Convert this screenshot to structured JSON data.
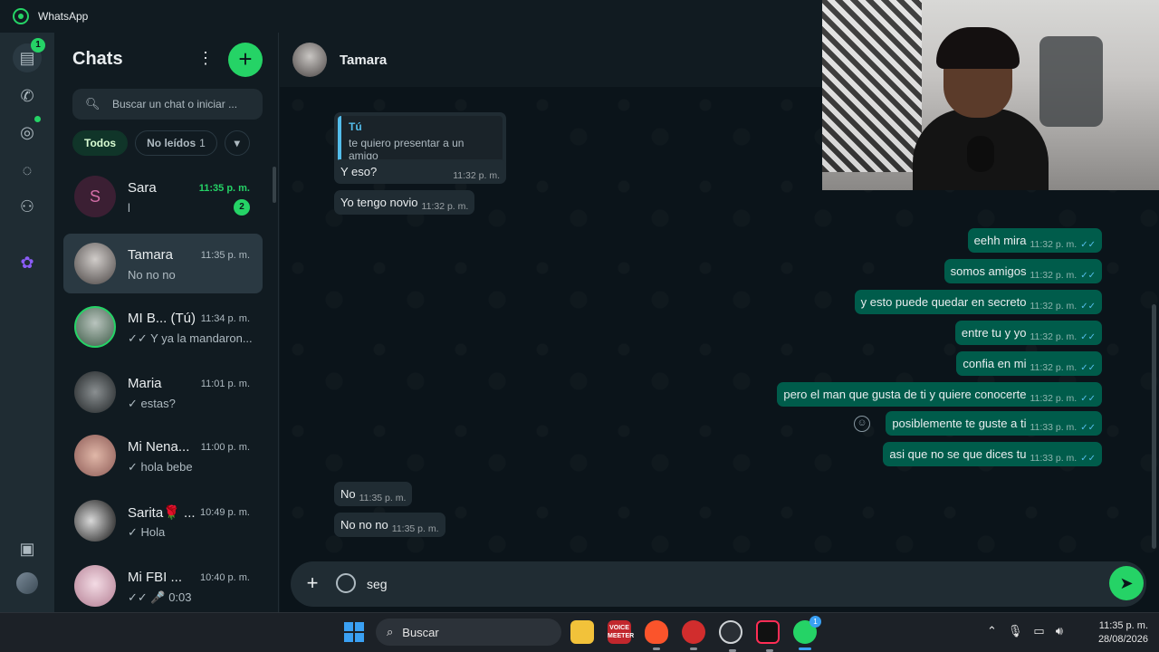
{
  "window": {
    "title": "WhatsApp"
  },
  "rail": {
    "chats_badge": "1"
  },
  "chat_list": {
    "title": "Chats",
    "search_placeholder": "Buscar un chat o iniciar ...",
    "filters": {
      "all": "Todos",
      "unread": "No leídos",
      "unread_count": "1"
    },
    "items": [
      {
        "name": "Sara",
        "time": "11:35 p. m.",
        "preview": "l",
        "unread": "2",
        "avatar_letter": "S",
        "avatar_color": "#3b1f33"
      },
      {
        "name": "Tamara",
        "time": "11:35 p. m.",
        "preview": "No no no",
        "avatar_color": "#8f8a86"
      },
      {
        "name": "MI B... (Tú)",
        "time": "11:34 p. m.",
        "preview": "✓✓ Y ya la mandaron...",
        "avatar_color": "#5a7a62"
      },
      {
        "name": "Maria",
        "time": "11:01 p. m.",
        "preview": "✓ estas?",
        "avatar_color": "#3e4447"
      },
      {
        "name": "Mi Nena...",
        "time": "11:00 p. m.",
        "preview": "✓ hola bebe",
        "avatar_color": "#9c6f6a"
      },
      {
        "name": "Sarita🌹 ...",
        "time": "10:49 p. m.",
        "preview": "✓ Hola",
        "avatar_color": "#2b2b2b"
      },
      {
        "name": "Mi FBI ...",
        "time": "10:40 p. m.",
        "preview": "✓✓ 🎤 0:03",
        "avatar_color": "#d9b8c4"
      }
    ]
  },
  "conversation": {
    "contact": "Tamara",
    "quote": {
      "author": "Tú",
      "text": "te quiero presentar a un amigo"
    },
    "messages_in_top": [
      {
        "text": "Y eso?",
        "time": "11:32 p. m."
      },
      {
        "text": "Yo tengo novio",
        "time": "11:32 p. m."
      }
    ],
    "messages_out": [
      {
        "text": "eehh mira",
        "time": "11:32 p. m."
      },
      {
        "text": "somos amigos",
        "time": "11:32 p. m."
      },
      {
        "text": "y esto puede quedar en secreto",
        "time": "11:32 p. m."
      },
      {
        "text": "entre tu y yo",
        "time": "11:32 p. m."
      },
      {
        "text": "confia en mi",
        "time": "11:32 p. m."
      },
      {
        "text": "pero el man que gusta de ti y quiere conocerte",
        "time": "11:32 p. m."
      },
      {
        "text": "posiblemente te guste a ti",
        "time": "11:33 p. m."
      },
      {
        "text": "asi que no se que dices tu",
        "time": "11:33 p. m."
      }
    ],
    "messages_in_bottom": [
      {
        "text": "No",
        "time": "11:35 p. m."
      },
      {
        "text": "No no no",
        "time": "11:35 p. m."
      }
    ],
    "composer_value": "seg"
  },
  "taskbar": {
    "search_label": "Buscar",
    "voicemeeter_label": "VOICE MEETER",
    "wa_badge": "1",
    "time": "11:35 p. m.",
    "date": "28/08/2026"
  },
  "colors": {
    "accent": "#25d366",
    "outgoing": "#005c4b",
    "incoming": "#202c33",
    "read_tick": "#53bdeb"
  }
}
